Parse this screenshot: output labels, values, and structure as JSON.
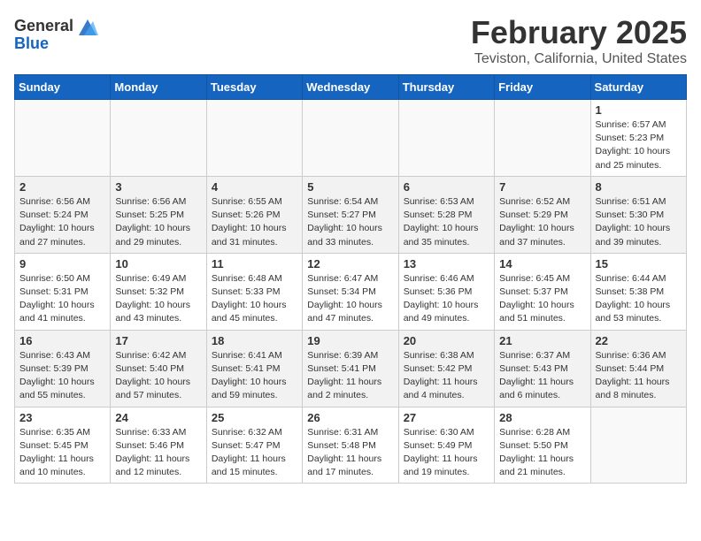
{
  "header": {
    "logo_general": "General",
    "logo_blue": "Blue",
    "month": "February 2025",
    "location": "Teviston, California, United States"
  },
  "days_of_week": [
    "Sunday",
    "Monday",
    "Tuesday",
    "Wednesday",
    "Thursday",
    "Friday",
    "Saturday"
  ],
  "weeks": [
    [
      {
        "day": "",
        "info": ""
      },
      {
        "day": "",
        "info": ""
      },
      {
        "day": "",
        "info": ""
      },
      {
        "day": "",
        "info": ""
      },
      {
        "day": "",
        "info": ""
      },
      {
        "day": "",
        "info": ""
      },
      {
        "day": "1",
        "info": "Sunrise: 6:57 AM\nSunset: 5:23 PM\nDaylight: 10 hours and 25 minutes."
      }
    ],
    [
      {
        "day": "2",
        "info": "Sunrise: 6:56 AM\nSunset: 5:24 PM\nDaylight: 10 hours and 27 minutes."
      },
      {
        "day": "3",
        "info": "Sunrise: 6:56 AM\nSunset: 5:25 PM\nDaylight: 10 hours and 29 minutes."
      },
      {
        "day": "4",
        "info": "Sunrise: 6:55 AM\nSunset: 5:26 PM\nDaylight: 10 hours and 31 minutes."
      },
      {
        "day": "5",
        "info": "Sunrise: 6:54 AM\nSunset: 5:27 PM\nDaylight: 10 hours and 33 minutes."
      },
      {
        "day": "6",
        "info": "Sunrise: 6:53 AM\nSunset: 5:28 PM\nDaylight: 10 hours and 35 minutes."
      },
      {
        "day": "7",
        "info": "Sunrise: 6:52 AM\nSunset: 5:29 PM\nDaylight: 10 hours and 37 minutes."
      },
      {
        "day": "8",
        "info": "Sunrise: 6:51 AM\nSunset: 5:30 PM\nDaylight: 10 hours and 39 minutes."
      }
    ],
    [
      {
        "day": "9",
        "info": "Sunrise: 6:50 AM\nSunset: 5:31 PM\nDaylight: 10 hours and 41 minutes."
      },
      {
        "day": "10",
        "info": "Sunrise: 6:49 AM\nSunset: 5:32 PM\nDaylight: 10 hours and 43 minutes."
      },
      {
        "day": "11",
        "info": "Sunrise: 6:48 AM\nSunset: 5:33 PM\nDaylight: 10 hours and 45 minutes."
      },
      {
        "day": "12",
        "info": "Sunrise: 6:47 AM\nSunset: 5:34 PM\nDaylight: 10 hours and 47 minutes."
      },
      {
        "day": "13",
        "info": "Sunrise: 6:46 AM\nSunset: 5:36 PM\nDaylight: 10 hours and 49 minutes."
      },
      {
        "day": "14",
        "info": "Sunrise: 6:45 AM\nSunset: 5:37 PM\nDaylight: 10 hours and 51 minutes."
      },
      {
        "day": "15",
        "info": "Sunrise: 6:44 AM\nSunset: 5:38 PM\nDaylight: 10 hours and 53 minutes."
      }
    ],
    [
      {
        "day": "16",
        "info": "Sunrise: 6:43 AM\nSunset: 5:39 PM\nDaylight: 10 hours and 55 minutes."
      },
      {
        "day": "17",
        "info": "Sunrise: 6:42 AM\nSunset: 5:40 PM\nDaylight: 10 hours and 57 minutes."
      },
      {
        "day": "18",
        "info": "Sunrise: 6:41 AM\nSunset: 5:41 PM\nDaylight: 10 hours and 59 minutes."
      },
      {
        "day": "19",
        "info": "Sunrise: 6:39 AM\nSunset: 5:41 PM\nDaylight: 11 hours and 2 minutes."
      },
      {
        "day": "20",
        "info": "Sunrise: 6:38 AM\nSunset: 5:42 PM\nDaylight: 11 hours and 4 minutes."
      },
      {
        "day": "21",
        "info": "Sunrise: 6:37 AM\nSunset: 5:43 PM\nDaylight: 11 hours and 6 minutes."
      },
      {
        "day": "22",
        "info": "Sunrise: 6:36 AM\nSunset: 5:44 PM\nDaylight: 11 hours and 8 minutes."
      }
    ],
    [
      {
        "day": "23",
        "info": "Sunrise: 6:35 AM\nSunset: 5:45 PM\nDaylight: 11 hours and 10 minutes."
      },
      {
        "day": "24",
        "info": "Sunrise: 6:33 AM\nSunset: 5:46 PM\nDaylight: 11 hours and 12 minutes."
      },
      {
        "day": "25",
        "info": "Sunrise: 6:32 AM\nSunset: 5:47 PM\nDaylight: 11 hours and 15 minutes."
      },
      {
        "day": "26",
        "info": "Sunrise: 6:31 AM\nSunset: 5:48 PM\nDaylight: 11 hours and 17 minutes."
      },
      {
        "day": "27",
        "info": "Sunrise: 6:30 AM\nSunset: 5:49 PM\nDaylight: 11 hours and 19 minutes."
      },
      {
        "day": "28",
        "info": "Sunrise: 6:28 AM\nSunset: 5:50 PM\nDaylight: 11 hours and 21 minutes."
      },
      {
        "day": "",
        "info": ""
      }
    ]
  ]
}
